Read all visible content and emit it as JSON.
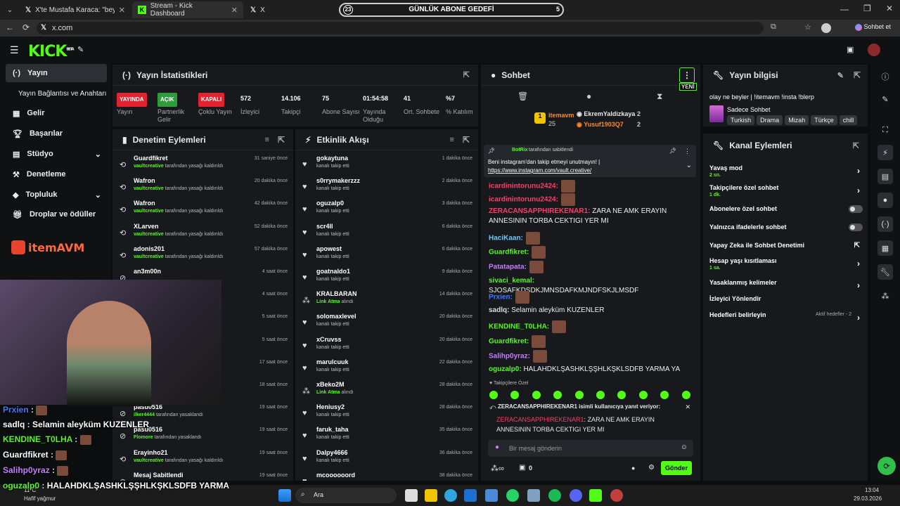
{
  "browser": {
    "tabs": [
      {
        "title": "X'te Mustafa Karaca: \"beyler elimd"
      },
      {
        "title": "Stream - Kick Dashboard"
      },
      {
        "title": "X"
      }
    ],
    "url": "x.com",
    "chat_btn": "Sohbet et"
  },
  "goal": {
    "left": "23",
    "title": "GÜNLÜK ABONE GEDEFİ",
    "right": "5"
  },
  "kick": {
    "logo": "KICK",
    "beta": "BETA"
  },
  "sidebar": {
    "items": [
      {
        "label": "Yayın"
      },
      {
        "label": "Yayın Bağlantısı ve Anahtarı"
      },
      {
        "label": "Gelir"
      },
      {
        "label": "Başarılar"
      },
      {
        "label": "Stüdyo"
      },
      {
        "label": "Denetleme"
      },
      {
        "label": "Topluluk"
      },
      {
        "label": "Droplar ve ödüller"
      }
    ]
  },
  "sponsor": "itemAVM",
  "stats": {
    "title": "Yayın İstatistikleri",
    "items": [
      {
        "value": "YAYINDA",
        "label": "Yayın",
        "badge": true,
        "color": "#e0232e"
      },
      {
        "value": "AÇIK",
        "label": "Partnerlik Gelir",
        "badge": true,
        "color": "#2f9c3c"
      },
      {
        "value": "KAPALI",
        "label": "Çoklu Yayın",
        "badge": true,
        "color": "#e0232e"
      },
      {
        "value": "572",
        "label": "İzleyici"
      },
      {
        "value": "14.106",
        "label": "Takipçi"
      },
      {
        "value": "75",
        "label": "Abone Sayısı"
      },
      {
        "value": "01:54:58",
        "label": "Yayında Olduğu"
      },
      {
        "value": "41",
        "label": "Ort. Sohbete"
      },
      {
        "value": "%7",
        "label": "% Katılım"
      }
    ]
  },
  "moderation": {
    "title": "Denetim Eylemleri",
    "items": [
      {
        "name": "Guardfikret",
        "mod": "vaultcreative",
        "action": "tarafından yasağı kaldırıldı",
        "time": "31 saniye önce"
      },
      {
        "name": "Wafron",
        "mod": "vaultcreative",
        "action": "tarafından yasağı kaldırıldı",
        "time": "20 dakika önce"
      },
      {
        "name": "Wafron",
        "mod": "vaultcreative",
        "action": "tarafından yasağı kaldırıldı",
        "time": "42 dakika önce"
      },
      {
        "name": "XLarven",
        "mod": "vaultcreative",
        "action": "tarafından yasağı kaldırıldı",
        "time": "52 dakika önce"
      },
      {
        "name": "adonis201",
        "mod": "vaultcreative",
        "action": "tarafından yasağı kaldırıldı",
        "time": "57 dakika önce"
      },
      {
        "name": "an3m00n",
        "mod": "",
        "action": "",
        "time": "4 saat önce"
      },
      {
        "name": "",
        "mod": "",
        "action": "ındı",
        "time": "4 saat önce"
      },
      {
        "name": "",
        "mod": "",
        "action": "",
        "time": "5 saat önce"
      },
      {
        "name": "",
        "mod": "",
        "action": "",
        "time": "5 saat önce"
      },
      {
        "name": "",
        "mod": "",
        "action": "",
        "time": "17 saat önce"
      },
      {
        "name": "",
        "mod": "",
        "action": "",
        "time": "18 saat önce"
      },
      {
        "name": "pasu0516",
        "mod": "ilker4444",
        "action": "tarafından yasaklandı",
        "time": "19 saat önce"
      },
      {
        "name": "pasu0516",
        "mod": "Flomore",
        "action": "tarafından yasaklandı",
        "time": "19 saat önce"
      },
      {
        "name": "Erayinho21",
        "mod": "vaultcreative",
        "action": "tarafından yasağı kaldırıldı",
        "time": "19 saat önce"
      },
      {
        "name": "Mesaj Sabitlendi",
        "mod": "",
        "action": "",
        "time": "19 saat önce"
      }
    ]
  },
  "activity": {
    "title": "Etkinlik Akışı",
    "items": [
      {
        "name": "gokaytuna",
        "sub": "kanalı takip etti",
        "time": "1 dakika önce",
        "type": "heart"
      },
      {
        "name": "s0rrymakerzzz",
        "sub": "kanalı takip etti",
        "time": "2 dakika önce",
        "type": "heart"
      },
      {
        "name": "oguzalp0",
        "sub": "kanalı takip etti",
        "time": "3 dakika önce",
        "type": "heart"
      },
      {
        "name": "scr4ll",
        "sub": "kanalı takip etti",
        "time": "6 dakika önce",
        "type": "heart"
      },
      {
        "name": "apowest",
        "sub": "kanalı takip etti",
        "time": "6 dakika önce",
        "type": "heart"
      },
      {
        "name": "goatnaldo1",
        "sub": "kanalı takip etti",
        "time": "9 dakika önce",
        "type": "heart"
      },
      {
        "name": "KRALBARAN",
        "sub": "Link Atma",
        "sub2": "alındı",
        "time": "14 dakika önce",
        "type": "drop"
      },
      {
        "name": "solomaxlevel",
        "sub": "kanalı takip etti",
        "time": "20 dakika önce",
        "type": "heart"
      },
      {
        "name": "xCruvss",
        "sub": "kanalı takip etti",
        "time": "20 dakika önce",
        "type": "heart"
      },
      {
        "name": "marulcuuk",
        "sub": "kanalı takip etti",
        "time": "22 dakika önce",
        "type": "heart"
      },
      {
        "name": "xBeko2M",
        "sub": "Link Atma",
        "sub2": "alındı",
        "time": "28 dakika önce",
        "type": "drop"
      },
      {
        "name": "Heniusy2",
        "sub": "kanalı takip etti",
        "time": "28 dakika önce",
        "type": "heart"
      },
      {
        "name": "faruk_taha",
        "sub": "kanalı takip etti",
        "time": "35 dakika önce",
        "type": "heart"
      },
      {
        "name": "Dalpy4666",
        "sub": "kanalı takip etti",
        "time": "36 dakika önce",
        "type": "heart"
      },
      {
        "name": "mcoooooord",
        "sub": "",
        "time": "38 dakika önce",
        "type": "heart"
      }
    ]
  },
  "chat": {
    "title": "Sohbet",
    "new_label": "YENİ",
    "leader": {
      "name": "itemavm",
      "count": "25"
    },
    "top": [
      {
        "name": "EkremYaldizkaya",
        "count": "2"
      },
      {
        "name": "Yusuf1903Q7",
        "count": "2"
      }
    ],
    "pinned": {
      "by": "BotRix",
      "by_text": "tarafından sabitlendi",
      "text": "Beni instagram'dan takip etmeyi unutmayın! |",
      "link": "https://www.instagram.com/vault.creative/"
    },
    "messages": [
      {
        "user": "icardinintorunu2424:",
        "color": "#ff3c6a",
        "text": "",
        "emote": true
      },
      {
        "user": "icardinintorunu2424:",
        "color": "#ff3c6a",
        "text": "",
        "emote": true
      },
      {
        "user": "ZERACANSAPPHIREKENAR1:",
        "color": "#ff3c6a",
        "text": "ZARA NE AMK ERAYIN ANNESININ TORBA CEKTIGI YER MI",
        "emote": false
      },
      {
        "user": "HaciKaan:",
        "color": "#6ec6ff",
        "text": "",
        "emote": true
      },
      {
        "user": "Guardfikret:",
        "color": "#53fc18",
        "text": "",
        "emote": true
      },
      {
        "user": "Patatapata:",
        "color": "#c77dff",
        "text": "",
        "emote": true
      },
      {
        "user": "sivaci_kemal:",
        "color": "#53fc18",
        "text": "SJOSAFKDSDKJMNSDAFKMJNDFSKJLMSDF",
        "emote": false
      },
      {
        "user": "Prxien:",
        "color": "#3d7bff",
        "text": "",
        "emote": true
      },
      {
        "user": "sadlq:",
        "color": "#dddddd",
        "text": "Selamin aleyküm KUZENLER",
        "emote": false
      },
      {
        "user": "KENDINE_T0LHA:",
        "color": "#53fc18",
        "text": "",
        "emote": true
      },
      {
        "user": "Guardfikret:",
        "color": "#53fc18",
        "text": "",
        "emote": true
      },
      {
        "user": "Salihp0yraz:",
        "color": "#c77dff",
        "text": "",
        "emote": true
      },
      {
        "user": "oguzalp0:",
        "color": "#53fc18",
        "text": "HALAHDKLŞASHKLŞŞHLKŞKLSDFB YARMA YA",
        "emote": false
      }
    ],
    "followers_only": "Takipçilere Özel",
    "reply_to": "ZERACANSAPPHIREKENAR1 isimli kullanıcıya yanıt veriyor:",
    "reply_user": "ZERACANSAPPHIREKENAR1",
    "reply_text": "ZARA NE AMK ERAYIN ANNESININ TORBA CEKTIGI YER MI",
    "input_placeholder": "Bir mesaj gönderin",
    "count": "0",
    "send": "Gönder"
  },
  "info": {
    "title": "Yayın bilgisi",
    "stream_title": "olay ne beyler | !itemavm !insta !blerp",
    "category": "Sadece Sohbet",
    "tags": [
      "Turkish",
      "Drama",
      "Mizah",
      "Türkçe",
      "chill"
    ]
  },
  "actions": {
    "title": "Kanal Eylemleri",
    "items": [
      {
        "label": "Yavaş mod",
        "sub": "2 sn.",
        "ctl": "chevron"
      },
      {
        "label": "Takipçilere özel sohbet",
        "sub": "1 dk.",
        "ctl": "chevron"
      },
      {
        "label": "Abonelere özel sohbet",
        "sub": "",
        "ctl": "toggle"
      },
      {
        "label": "Yalnızca ifadelerle sohbet",
        "sub": "",
        "ctl": "toggle"
      },
      {
        "label": "Yapay Zeka ile Sohbet Denetimi",
        "sub": "",
        "ctl": "ext"
      },
      {
        "label": "Hesap yaşı kısıtlaması",
        "sub": "1 sa.",
        "ctl": "chevron"
      },
      {
        "label": "Yasaklanmış kelimeler",
        "sub": "",
        "ctl": "chevron"
      },
      {
        "label": "İzleyici Yönlendir",
        "sub": "",
        "ctl": ""
      },
      {
        "label": "Hedefleri belirleyin",
        "sub": "",
        "ctl": "chevron",
        "extra": "Aktif hedefler - 2"
      }
    ]
  },
  "overlay": [
    {
      "user": "Prxien",
      "color": "#3d7bff",
      "text": ""
    },
    {
      "user": "sadlq",
      "color": "#ffffff",
      "text": "Selamin aleyküm KUZENLER"
    },
    {
      "user": "KENDINE_T0LHA",
      "color": "#53fc18",
      "text": ""
    },
    {
      "user": "Guardfikret",
      "color": "#ffffff",
      "text": ""
    },
    {
      "user": "Salihp0yraz",
      "color": "#c77dff",
      "text": ""
    },
    {
      "user": "oguzalp0",
      "color": "#53fc18",
      "text": "HALAHDKLŞASHKLŞŞHLKŞKLSDFB YARMA"
    }
  ],
  "overlay_tail": "YA",
  "weather": {
    "temp": "11°C",
    "desc": "Hafif yağmur"
  },
  "taskbar": {
    "search": "Ara",
    "time": "13:04",
    "date": "29.03.2026"
  }
}
